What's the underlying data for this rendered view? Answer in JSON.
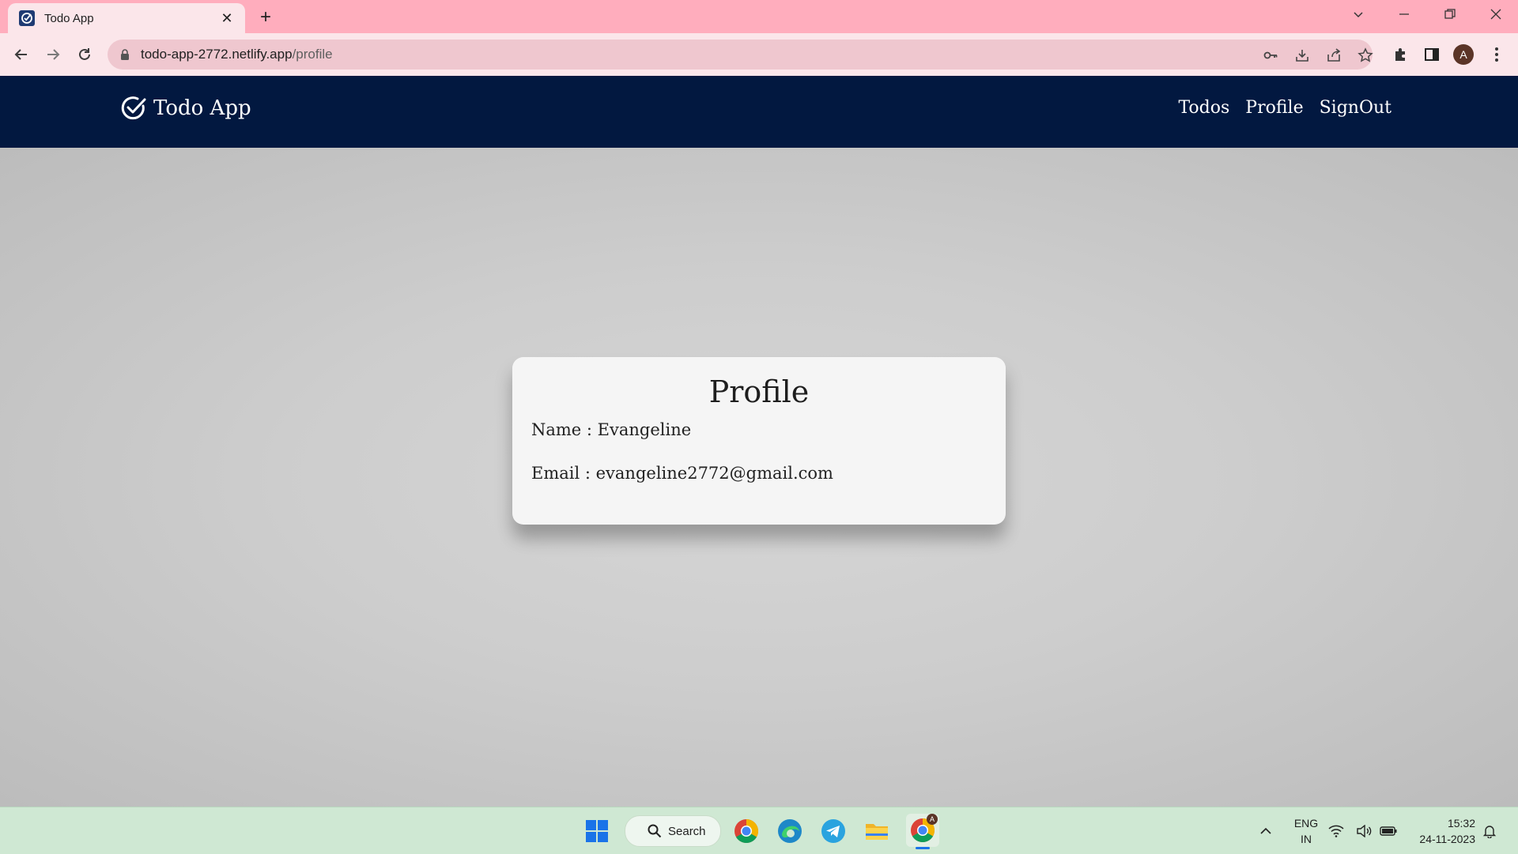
{
  "browser": {
    "tab_title": "Todo App",
    "url_host": "todo-app-2772.netlify.app",
    "url_path": "/profile",
    "profile_initial": "A"
  },
  "app": {
    "brand": "Todo App",
    "nav": [
      "Todos",
      "Profile",
      "SignOut"
    ],
    "brand_color": "#021840"
  },
  "profile": {
    "heading": "Profile",
    "name_line": "Name : Evangeline",
    "email_line": "Email : evangeline2772@gmail.com"
  },
  "taskbar": {
    "search_label": "Search",
    "lang_top": "ENG",
    "lang_bottom": "IN",
    "time": "15:32",
    "date": "24-11-2023",
    "badge": "A"
  }
}
